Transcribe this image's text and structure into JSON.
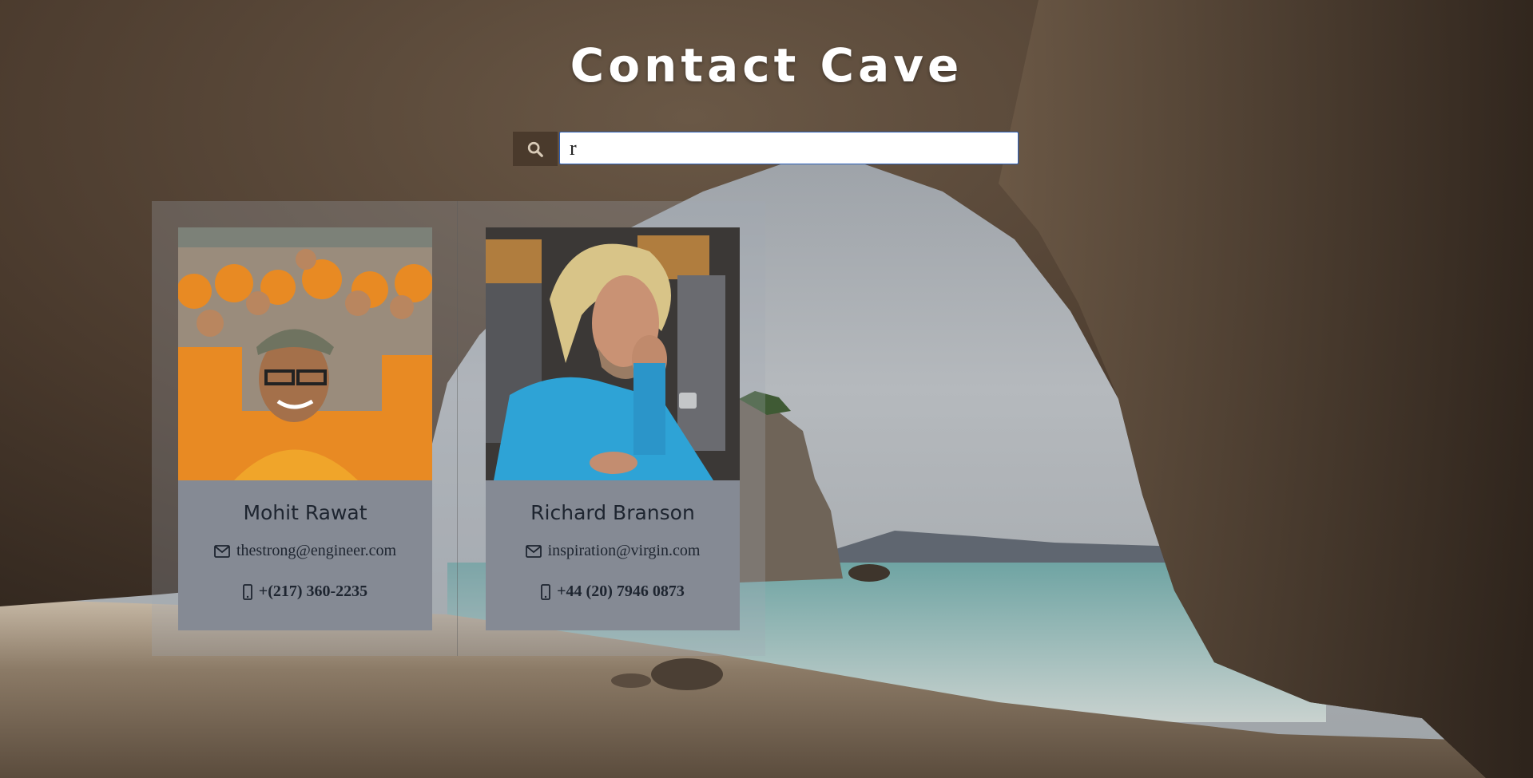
{
  "app": {
    "title": "Contact Cave"
  },
  "search": {
    "value": "r",
    "icon": "search-icon"
  },
  "colors": {
    "card_bg": "#858a94",
    "title": "#ffffff",
    "search_btn": "#4a3a2c"
  },
  "contacts": [
    {
      "name": "Mohit Rawat",
      "email": "thestrong@engineer.com",
      "phone": "+(217) 360-2235"
    },
    {
      "name": "Richard Branson",
      "email": "inspiration@virgin.com",
      "phone": "+44 (20) 7946 0873"
    }
  ]
}
